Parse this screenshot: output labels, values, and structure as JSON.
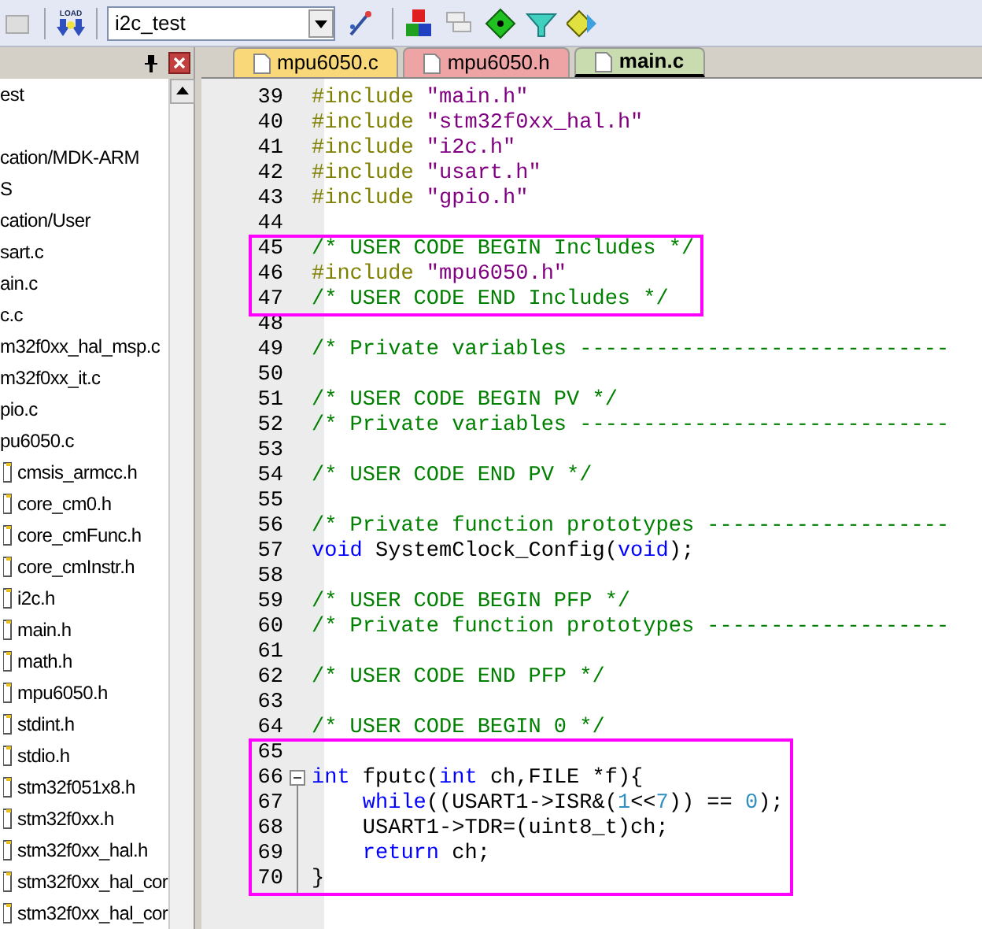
{
  "toolbar": {
    "load_label": "LOAD",
    "target": "i2c_test"
  },
  "project_tree": {
    "items": [
      {
        "label": "est",
        "children": [
          {
            "label": "cation/MDK-ARM"
          },
          {
            "label": "S"
          },
          {
            "label": "cation/User",
            "children": [
              {
                "label": "sart.c"
              },
              {
                "label": "ain.c"
              },
              {
                "label": "c.c"
              },
              {
                "label": "m32f0xx_hal_msp.c"
              },
              {
                "label": "m32f0xx_it.c"
              },
              {
                "label": "pio.c"
              },
              {
                "label": "pu6050.c",
                "children": [
                  {
                    "label": "cmsis_armcc.h"
                  },
                  {
                    "label": "core_cm0.h"
                  },
                  {
                    "label": "core_cmFunc.h"
                  },
                  {
                    "label": "core_cmInstr.h"
                  },
                  {
                    "label": "i2c.h"
                  },
                  {
                    "label": "main.h"
                  },
                  {
                    "label": "math.h"
                  },
                  {
                    "label": "mpu6050.h"
                  },
                  {
                    "label": "stdint.h"
                  },
                  {
                    "label": "stdio.h"
                  },
                  {
                    "label": "stm32f051x8.h"
                  },
                  {
                    "label": "stm32f0xx.h"
                  },
                  {
                    "label": "stm32f0xx_hal.h"
                  },
                  {
                    "label": "stm32f0xx_hal_cor"
                  },
                  {
                    "label": "stm32f0xx_hal_cor"
                  }
                ]
              }
            ]
          }
        ]
      }
    ]
  },
  "tabs": [
    {
      "label": "mpu6050.c",
      "selected": false,
      "color": "#f8d878"
    },
    {
      "label": "mpu6050.h",
      "selected": false,
      "color": "#eea4a4"
    },
    {
      "label": "main.c",
      "selected": true,
      "color": "#c8dcb0"
    }
  ],
  "code": [
    {
      "boxed": false,
      "lines": [
        {
          "number": "39",
          "fold_start": false,
          "fold_line": false,
          "segments": [
            {
              "kind": "pp",
              "text": "#include "
            },
            {
              "kind": "str",
              "text": "\"main.h\""
            }
          ]
        },
        {
          "number": "40",
          "fold_start": false,
          "fold_line": false,
          "segments": [
            {
              "kind": "pp",
              "text": "#include "
            },
            {
              "kind": "str",
              "text": "\"stm32f0xx_hal.h\""
            }
          ]
        },
        {
          "number": "41",
          "fold_start": false,
          "fold_line": false,
          "segments": [
            {
              "kind": "pp",
              "text": "#include "
            },
            {
              "kind": "str",
              "text": "\"i2c.h\""
            }
          ]
        },
        {
          "number": "42",
          "fold_start": false,
          "fold_line": false,
          "segments": [
            {
              "kind": "pp",
              "text": "#include "
            },
            {
              "kind": "str",
              "text": "\"usart.h\""
            }
          ]
        },
        {
          "number": "43",
          "fold_start": false,
          "fold_line": false,
          "segments": [
            {
              "kind": "pp",
              "text": "#include "
            },
            {
              "kind": "str",
              "text": "\"gpio.h\""
            }
          ]
        },
        {
          "number": "44",
          "fold_start": false,
          "fold_line": false
        }
      ]
    },
    {
      "boxed": true,
      "lines": [
        {
          "number": "45",
          "fold_start": false,
          "fold_line": false,
          "segments": [
            {
              "kind": "cm",
              "text": "/* USER CODE BEGIN Includes */"
            }
          ]
        },
        {
          "number": "46",
          "fold_start": false,
          "fold_line": false,
          "segments": [
            {
              "kind": "pp",
              "text": "#include "
            },
            {
              "kind": "str",
              "text": "\"mpu6050.h\""
            }
          ]
        },
        {
          "number": "47",
          "fold_start": false,
          "fold_line": false,
          "segments": [
            {
              "kind": "cm",
              "text": "/* USER CODE END Includes */"
            }
          ]
        }
      ]
    },
    {
      "boxed": false,
      "lines": [
        {
          "number": "48",
          "fold_start": false,
          "fold_line": false
        },
        {
          "number": "49",
          "fold_start": false,
          "fold_line": false,
          "segments": [
            {
              "kind": "cm",
              "text": "/* Private variables -----------------------------"
            }
          ]
        },
        {
          "number": "50",
          "fold_start": false,
          "fold_line": false
        },
        {
          "number": "51",
          "fold_start": false,
          "fold_line": false,
          "segments": [
            {
              "kind": "cm",
              "text": "/* USER CODE BEGIN PV */"
            }
          ]
        },
        {
          "number": "52",
          "fold_start": false,
          "fold_line": false,
          "segments": [
            {
              "kind": "cm",
              "text": "/* Private variables -----------------------------"
            }
          ]
        },
        {
          "number": "53",
          "fold_start": false,
          "fold_line": false
        },
        {
          "number": "54",
          "fold_start": false,
          "fold_line": false,
          "segments": [
            {
              "kind": "cm",
              "text": "/* USER CODE END PV */"
            }
          ]
        },
        {
          "number": "55",
          "fold_start": false,
          "fold_line": false
        },
        {
          "number": "56",
          "fold_start": false,
          "fold_line": false,
          "segments": [
            {
              "kind": "cm",
              "text": "/* Private function prototypes -------------------"
            }
          ]
        },
        {
          "number": "57",
          "fold_start": false,
          "fold_line": false,
          "segments": [
            {
              "kind": "kw",
              "text": "void"
            },
            {
              "kind": "tx",
              "text": " SystemClock_Config("
            },
            {
              "kind": "kw",
              "text": "void"
            },
            {
              "kind": "tx",
              "text": ");"
            }
          ]
        },
        {
          "number": "58",
          "fold_start": false,
          "fold_line": false
        },
        {
          "number": "59",
          "fold_start": false,
          "fold_line": false,
          "segments": [
            {
              "kind": "cm",
              "text": "/* USER CODE BEGIN PFP */"
            }
          ]
        },
        {
          "number": "60",
          "fold_start": false,
          "fold_line": false,
          "segments": [
            {
              "kind": "cm",
              "text": "/* Private function prototypes -------------------"
            }
          ]
        },
        {
          "number": "61",
          "fold_start": false,
          "fold_line": false
        },
        {
          "number": "62",
          "fold_start": false,
          "fold_line": false,
          "segments": [
            {
              "kind": "cm",
              "text": "/* USER CODE END PFP */"
            }
          ]
        },
        {
          "number": "63",
          "fold_start": false,
          "fold_line": false
        },
        {
          "number": "64",
          "fold_start": false,
          "fold_line": false,
          "segments": [
            {
              "kind": "cm",
              "text": "/* USER CODE BEGIN 0 */"
            }
          ]
        }
      ]
    },
    {
      "boxed": true,
      "lines": [
        {
          "number": "65",
          "fold_start": false,
          "fold_line": false
        },
        {
          "number": "66",
          "fold_start": true,
          "fold_line": false,
          "segments": [
            {
              "kind": "kw",
              "text": "int"
            },
            {
              "kind": "tx",
              "text": " fputc("
            },
            {
              "kind": "kw",
              "text": "int"
            },
            {
              "kind": "tx",
              "text": " ch,FILE *f){"
            }
          ]
        },
        {
          "number": "67",
          "fold_start": false,
          "fold_line": true,
          "segments": [
            {
              "kind": "kw",
              "text": "    while"
            },
            {
              "kind": "tx",
              "text": "((USART1->ISR&("
            },
            {
              "kind": "num",
              "text": "1"
            },
            {
              "kind": "tx",
              "text": "<<"
            },
            {
              "kind": "num",
              "text": "7"
            },
            {
              "kind": "tx",
              "text": ")) == "
            },
            {
              "kind": "num",
              "text": "0"
            },
            {
              "kind": "tx",
              "text": ");"
            }
          ]
        },
        {
          "number": "68",
          "fold_start": false,
          "fold_line": true,
          "segments": [
            {
              "kind": "tx",
              "text": "    USART1->TDR=(uint8_t)ch;"
            }
          ]
        },
        {
          "number": "69",
          "fold_start": false,
          "fold_line": true,
          "segments": [
            {
              "kind": "kw",
              "text": "    return"
            },
            {
              "kind": "tx",
              "text": " ch;"
            }
          ]
        },
        {
          "number": "70",
          "fold_start": false,
          "fold_line": true,
          "segments": [
            {
              "kind": "tx",
              "text": "}"
            }
          ]
        }
      ]
    }
  ]
}
